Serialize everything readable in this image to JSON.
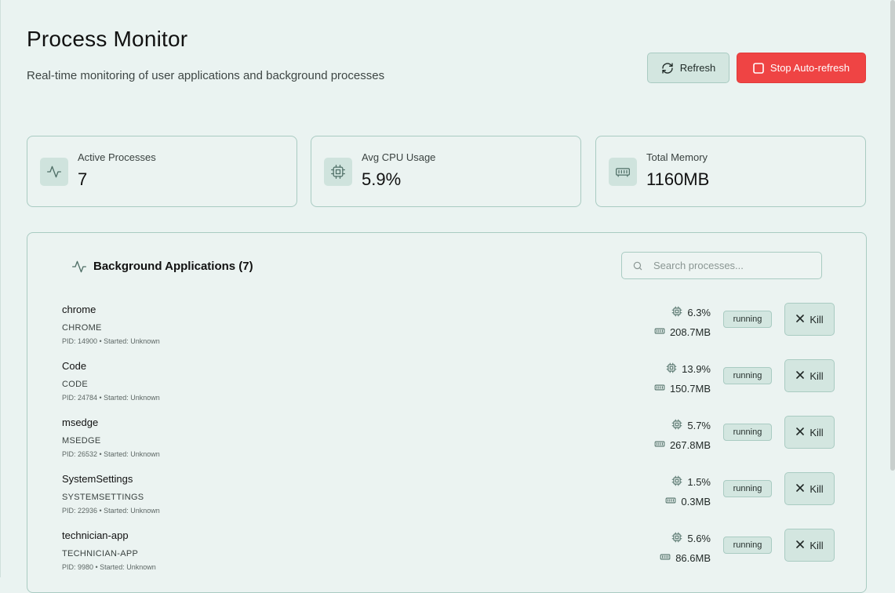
{
  "header": {
    "title": "Process Monitor",
    "subtitle": "Real-time monitoring of user applications and background processes",
    "refresh_label": "Refresh",
    "stop_label": "Stop Auto-refresh"
  },
  "stats": [
    {
      "label": "Active Processes",
      "value": "7",
      "icon": "activity-icon"
    },
    {
      "label": "Avg CPU Usage",
      "value": "5.9%",
      "icon": "cpu-icon"
    },
    {
      "label": "Total Memory",
      "value": "1160MB",
      "icon": "memory-icon"
    }
  ],
  "panel": {
    "title": "Background Applications (7)",
    "search_placeholder": "Search processes..."
  },
  "processes": [
    {
      "name": "chrome",
      "exe": "CHROME",
      "meta": "PID: 14900 • Started: Unknown",
      "cpu": "6.3%",
      "mem": "208.7MB",
      "status": "running",
      "kill": "Kill"
    },
    {
      "name": "Code",
      "exe": "CODE",
      "meta": "PID: 24784 • Started: Unknown",
      "cpu": "13.9%",
      "mem": "150.7MB",
      "status": "running",
      "kill": "Kill"
    },
    {
      "name": "msedge",
      "exe": "MSEDGE",
      "meta": "PID: 26532 • Started: Unknown",
      "cpu": "5.7%",
      "mem": "267.8MB",
      "status": "running",
      "kill": "Kill"
    },
    {
      "name": "SystemSettings",
      "exe": "SYSTEMSETTINGS",
      "meta": "PID: 22936 • Started: Unknown",
      "cpu": "1.5%",
      "mem": "0.3MB",
      "status": "running",
      "kill": "Kill"
    },
    {
      "name": "technician-app",
      "exe": "TECHNICIAN-APP",
      "meta": "PID: 9980 • Started: Unknown",
      "cpu": "5.6%",
      "mem": "86.6MB",
      "status": "running",
      "kill": "Kill"
    }
  ],
  "colors": {
    "accent": "#ef4444",
    "surface": "#eaf3f1",
    "border": "#a9cbc2",
    "chip": "#d3e6e0"
  }
}
